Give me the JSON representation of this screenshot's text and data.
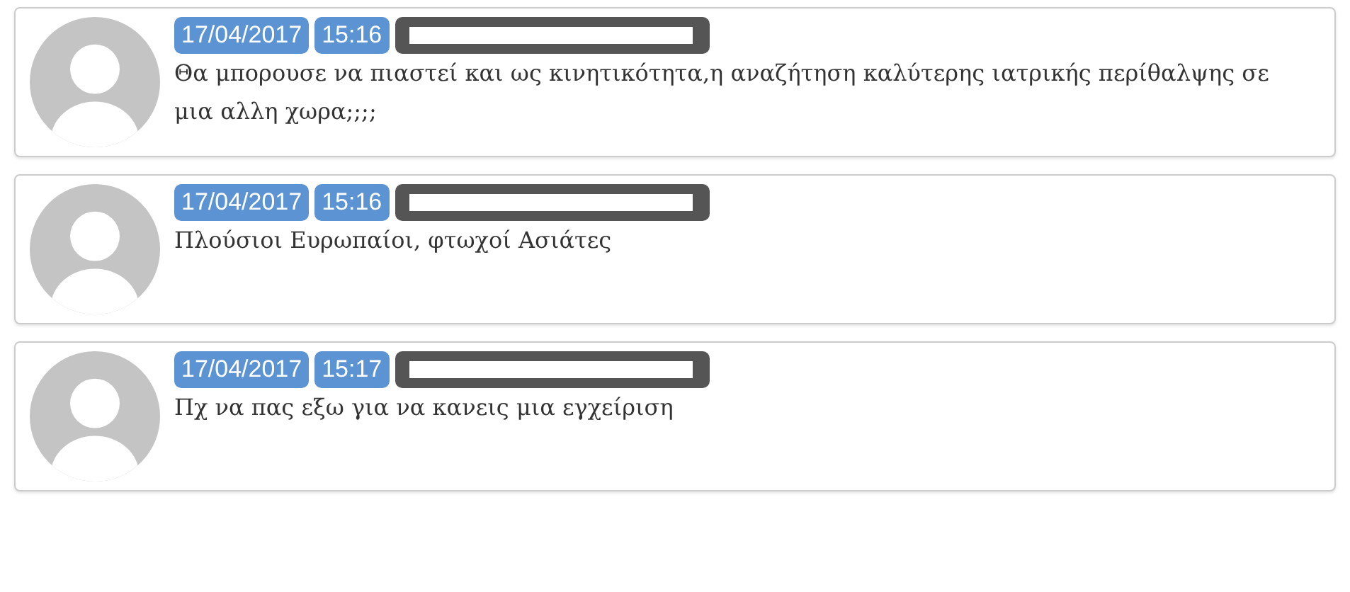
{
  "comments": [
    {
      "date": "17/04/2017",
      "time": "15:16",
      "author_redacted": true,
      "text": "Θα μπορουσε να πιαστεί και ως κινητικότητα,η αναζήτηση καλύτερης ιατρικής περίθαλψης σε μια αλλη χωρα;;;;"
    },
    {
      "date": "17/04/2017",
      "time": "15:16",
      "author_redacted": true,
      "text": "Πλούσιοι Ευρωπαίοι, φτωχοί Ασιάτες"
    },
    {
      "date": "17/04/2017",
      "time": "15:17",
      "author_redacted": true,
      "text": "Πχ να πας εξω για να κανεις μια εγχείριση"
    }
  ]
}
